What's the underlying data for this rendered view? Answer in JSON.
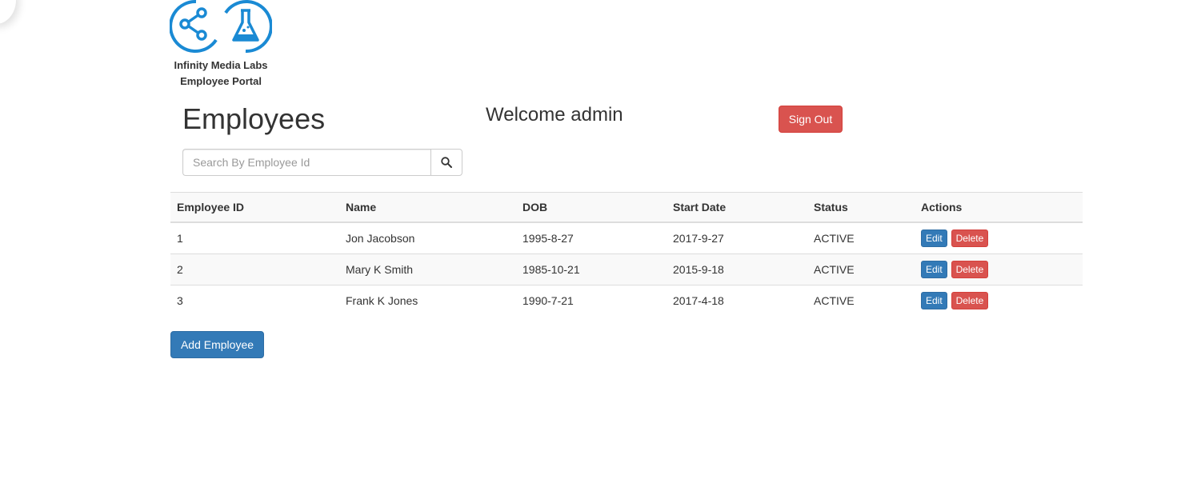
{
  "brand": {
    "line1": "Infinity Media Labs",
    "line2": "Employee Portal",
    "icon_color": "#1a8ad4"
  },
  "header": {
    "title": "Employees",
    "welcome": "Welcome admin",
    "sign_out_label": "Sign Out"
  },
  "search": {
    "placeholder": "Search By Employee Id",
    "value": ""
  },
  "table": {
    "columns": [
      "Employee ID",
      "Name",
      "DOB",
      "Start Date",
      "Status",
      "Actions"
    ],
    "rows": [
      {
        "id": "1",
        "name": "Jon Jacobson",
        "dob": "1995-8-27",
        "start": "2017-9-27",
        "status": "ACTIVE"
      },
      {
        "id": "2",
        "name": "Mary K Smith",
        "dob": "1985-10-21",
        "start": "2015-9-18",
        "status": "ACTIVE"
      },
      {
        "id": "3",
        "name": "Frank K Jones",
        "dob": "1990-7-21",
        "start": "2017-4-18",
        "status": "ACTIVE"
      }
    ],
    "edit_label": "Edit",
    "delete_label": "Delete"
  },
  "add_button_label": "Add Employee",
  "colors": {
    "primary": "#337ab7",
    "danger": "#d9534f"
  }
}
